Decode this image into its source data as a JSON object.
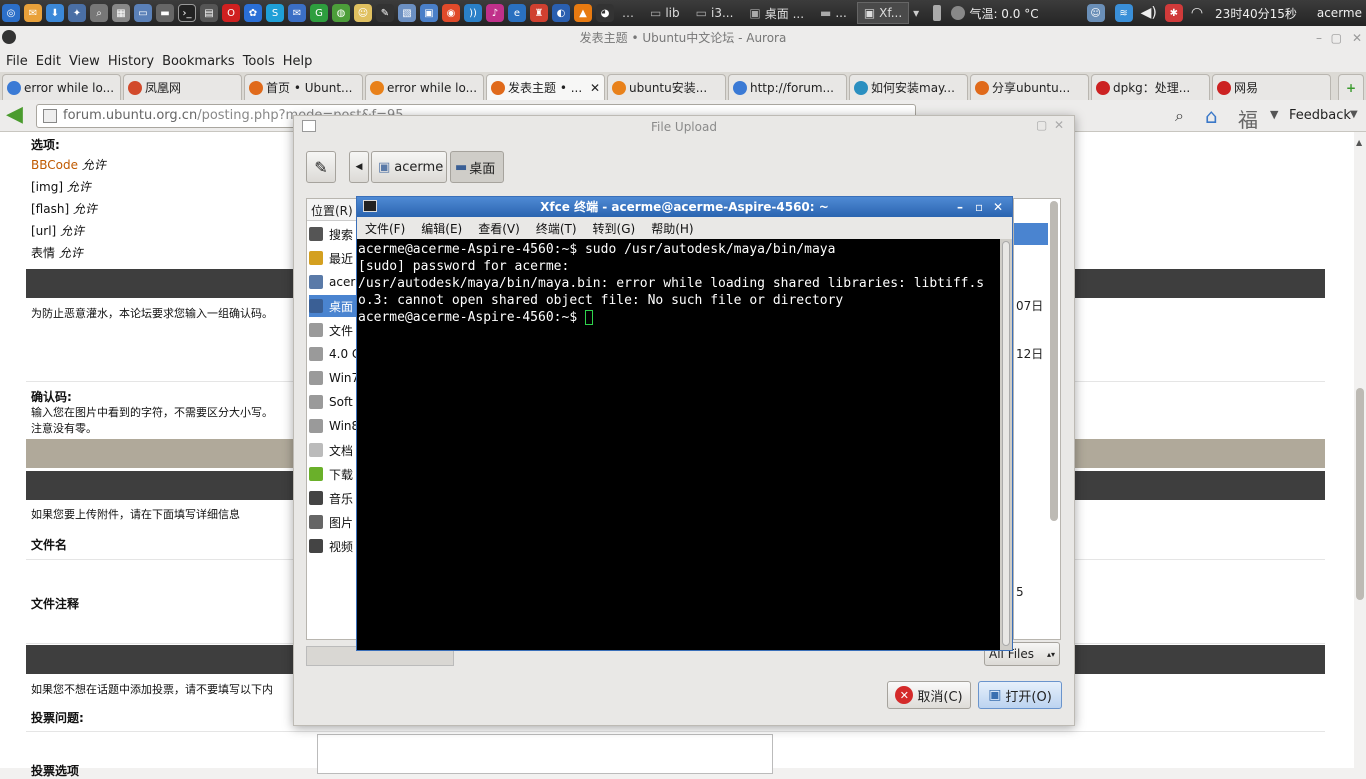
{
  "panel": {
    "tasks": [
      {
        "label": "lib",
        "active": false
      },
      {
        "label": "i3...",
        "active": false
      },
      {
        "label": "桌面 ...",
        "active": false
      },
      {
        "label": "...",
        "active": false
      },
      {
        "label": "Xf...",
        "active": true
      }
    ],
    "weather": "气温: 0.0 °C",
    "clock": "23时40分15秒",
    "user": "acerme"
  },
  "browser": {
    "title": "发表主题 • Ubuntu中文论坛 - Aurora",
    "menu": [
      "File",
      "Edit",
      "View",
      "History",
      "Bookmarks",
      "Tools",
      "Help"
    ],
    "tabs": [
      {
        "label": "error while lo...",
        "color": "#3a7ad5",
        "selected": false
      },
      {
        "label": "凤凰网",
        "color": "#d24a2b",
        "selected": false
      },
      {
        "label": "首页 • Ubunt...",
        "color": "#e06a1b",
        "selected": false
      },
      {
        "label": "error while lo...",
        "color": "#e8811a",
        "selected": false
      },
      {
        "label": "发表主题 • ...",
        "color": "#e06a1b",
        "selected": true
      },
      {
        "label": "ubuntu安装...",
        "color": "#e8811a",
        "selected": false
      },
      {
        "label": "http://forum...",
        "color": "#3a7ad5",
        "selected": false
      },
      {
        "label": "如何安装may...",
        "color": "#2a8fc0",
        "selected": false
      },
      {
        "label": "分享ubuntu...",
        "color": "#e06a1b",
        "selected": false
      },
      {
        "label": "dpkg：处理...",
        "color": "#cc2222",
        "selected": false
      },
      {
        "label": "网易",
        "color": "#cc2222",
        "selected": false
      }
    ],
    "url_host": "forum.ubuntu.org.cn",
    "url_path": "/posting.php?mode=post&f=95",
    "feedback": "Feedback"
  },
  "page": {
    "options_title": "选项:",
    "options": [
      {
        "name": "BBCode",
        "value": "允许"
      },
      {
        "name": "[img]",
        "value": "允许"
      },
      {
        "name": "[flash]",
        "value": "允许"
      },
      {
        "name": "[url]",
        "value": "允许"
      },
      {
        "name": "表情",
        "value": "允许"
      }
    ],
    "spam_notice": "为防止恶意灌水，本论坛要求您输入一组确认码。",
    "confirm_label": "确认码:",
    "confirm_help1": "输入您在图片中看到的字符，不需要区分大小写。",
    "confirm_help2": "注意没有零。",
    "upload_notice": "如果您要上传附件，请在下面填写详细信息",
    "filename_label": "文件名",
    "filecomment_label": "文件注释",
    "poll_notice": "如果您不想在话题中添加投票，请不要填写以下内",
    "poll_question_label": "投票问题:",
    "poll_option_label": "投票选项"
  },
  "dialog": {
    "title": "File Upload",
    "path": [
      "acerme",
      "桌面"
    ],
    "places_header": "位置(R)",
    "places": [
      {
        "label": "搜索",
        "icon": "search-icon"
      },
      {
        "label": "最近",
        "icon": "clock-icon"
      },
      {
        "label": "acer",
        "icon": "home-icon"
      },
      {
        "label": "桌面",
        "icon": "desktop-icon"
      },
      {
        "label": "文件",
        "icon": "drive-icon"
      },
      {
        "label": "4.0 G",
        "icon": "drive-icon"
      },
      {
        "label": "Win7",
        "icon": "drive-icon"
      },
      {
        "label": "Soft",
        "icon": "drive-icon"
      },
      {
        "label": "Win8",
        "icon": "drive-icon"
      },
      {
        "label": "文档",
        "icon": "document-icon"
      },
      {
        "label": "下载",
        "icon": "download-icon"
      },
      {
        "label": "音乐",
        "icon": "music-icon"
      },
      {
        "label": "图片",
        "icon": "picture-icon"
      },
      {
        "label": "视频",
        "icon": "video-icon"
      }
    ],
    "date_cells": [
      "07日",
      "12日",
      "5"
    ],
    "filter": "All Files",
    "cancel_label": "取消(C)",
    "open_label": "打开(O)"
  },
  "terminal": {
    "title": "Xfce 终端 - acerme@acerme-Aspire-4560: ~",
    "menu": [
      "文件(F)",
      "编辑(E)",
      "查看(V)",
      "终端(T)",
      "转到(G)",
      "帮助(H)"
    ],
    "lines": [
      "acerme@acerme-Aspire-4560:~$ sudo /usr/autodesk/maya/bin/maya",
      "[sudo] password for acerme:",
      "/usr/autodesk/maya/bin/maya.bin: error while loading shared libraries: libtiff.so.3: cannot open shared object file: No such file or directory"
    ],
    "prompt": "acerme@acerme-Aspire-4560:~$ "
  }
}
